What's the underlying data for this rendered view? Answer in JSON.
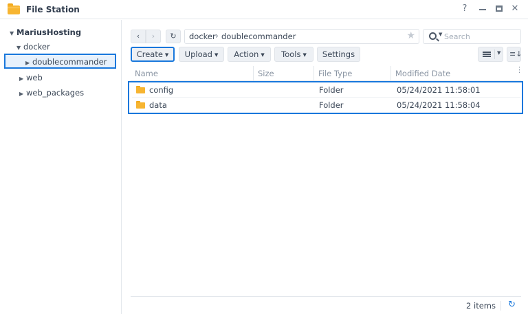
{
  "window": {
    "title": "File Station",
    "controls": {
      "help": "?",
      "close": "✕"
    }
  },
  "sidebar": {
    "root": "MariusHosting",
    "items": [
      {
        "label": "docker",
        "expanded": true
      },
      {
        "label": "doublecommander",
        "selected": true
      },
      {
        "label": "web",
        "expanded": false
      },
      {
        "label": "web_packages",
        "expanded": false
      }
    ]
  },
  "nav": {
    "back": "‹",
    "forward": "›",
    "refresh": "↻",
    "path": [
      "docker",
      "doublecommander"
    ],
    "separator": "›",
    "favorite": "★"
  },
  "search": {
    "placeholder": "Search",
    "value": ""
  },
  "toolbar": {
    "create": "Create",
    "upload": "Upload",
    "action": "Action",
    "tools": "Tools",
    "settings": "Settings",
    "sort_icon": "≡↓"
  },
  "table": {
    "columns": [
      "Name",
      "Size",
      "File Type",
      "Modified Date"
    ],
    "more": "⋮",
    "rows": [
      {
        "name": "config",
        "size": "",
        "type": "Folder",
        "modified": "05/24/2021 11:58:01"
      },
      {
        "name": "data",
        "size": "",
        "type": "Folder",
        "modified": "05/24/2021 11:58:04"
      }
    ]
  },
  "footer": {
    "count": "2 items",
    "refresh": "↻"
  },
  "colors": {
    "accent": "#1877dc",
    "folder": "#f7b531",
    "selection": "#e7f1fc"
  }
}
